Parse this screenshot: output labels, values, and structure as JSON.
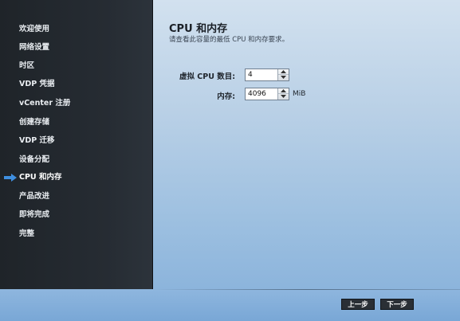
{
  "sidebar": {
    "steps": [
      {
        "label": "欢迎使用"
      },
      {
        "label": "网络设置"
      },
      {
        "label": "时区"
      },
      {
        "label": "VDP 凭据"
      },
      {
        "label": "vCenter 注册"
      },
      {
        "label": "创建存储"
      },
      {
        "label": "VDP 迁移"
      },
      {
        "label": "设备分配"
      },
      {
        "label": "CPU 和内存"
      },
      {
        "label": "产品改进"
      },
      {
        "label": "即将完成"
      },
      {
        "label": "完整"
      }
    ],
    "active_index": 8,
    "active_icon": "right-arrow-icon"
  },
  "main": {
    "title": "CPU 和内存",
    "subtitle": "请查看此容量的最低 CPU 和内存要求。",
    "cpu": {
      "label": "虚拟 CPU 数目:",
      "value": "4"
    },
    "memory": {
      "label": "内存:",
      "value": "4096",
      "unit": "MiB"
    }
  },
  "footer": {
    "back_label": "上一步",
    "next_label": "下一步"
  },
  "colors": {
    "sidebar_bg": "#262c33",
    "arrow": "#3f8fe0",
    "button_bg": "#2a2f35"
  }
}
